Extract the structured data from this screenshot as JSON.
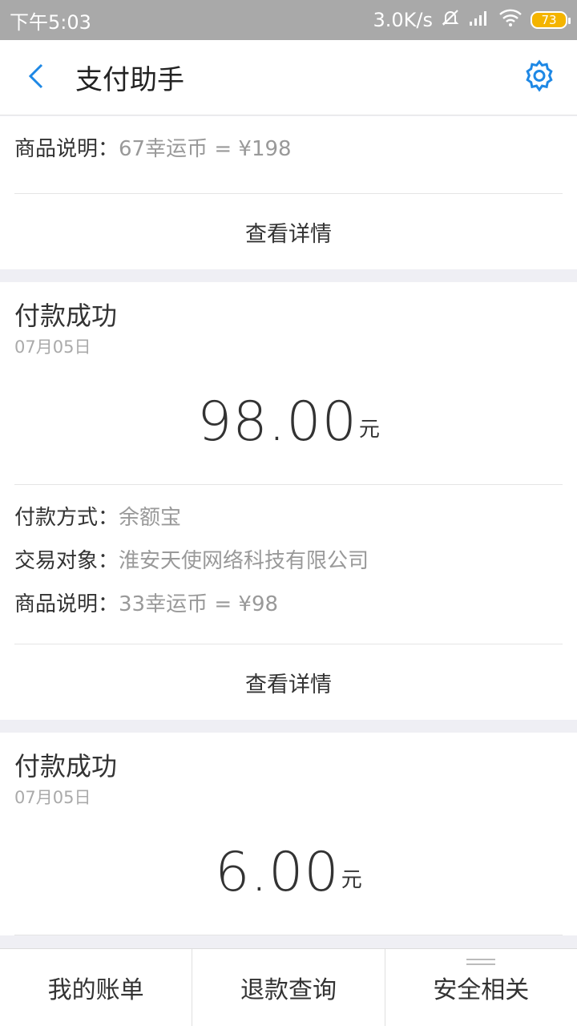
{
  "status_bar": {
    "time": "下午5:03",
    "network_speed": "3.0K/s",
    "battery": "73"
  },
  "header": {
    "title": "支付助手"
  },
  "cards": [
    {
      "rows": [
        {
          "label": "商品说明：",
          "value": "67幸运币 = ¥198"
        }
      ],
      "detail_label": "查看详情"
    },
    {
      "status": "付款成功",
      "date": "07月05日",
      "amount": "98.00",
      "unit": "元",
      "rows": [
        {
          "label": "付款方式：",
          "value": "余额宝"
        },
        {
          "label": "交易对象：",
          "value": "淮安天使网络科技有限公司"
        },
        {
          "label": "商品说明：",
          "value": "33幸运币 = ¥98"
        }
      ],
      "detail_label": "查看详情"
    },
    {
      "status": "付款成功",
      "date": "07月05日",
      "amount": "6.00",
      "unit": "元"
    }
  ],
  "tabs": [
    {
      "label": "我的账单"
    },
    {
      "label": "退款查询"
    },
    {
      "label": "安全相关"
    }
  ],
  "colors": {
    "accent": "#1e88e5",
    "status_bar": "#a9a9a9",
    "background": "#efeff4"
  }
}
